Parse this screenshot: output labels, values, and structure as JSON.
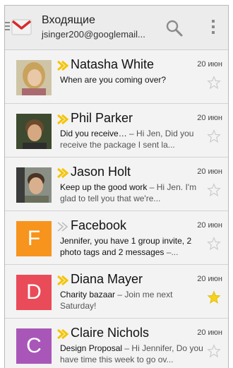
{
  "actionbar": {
    "title": "Входящие",
    "account": "jsinger200@googlemail...",
    "logo_icon": "gmail-envelope-icon",
    "search_icon": "search-icon",
    "overflow_icon": "overflow-menu-icon"
  },
  "colors": {
    "importance_marker": "#f5c400",
    "importance_marker_inactive": "#bdbdbd",
    "facebook_tile": "#f7941d",
    "diana_tile": "#e94b59",
    "claire_tile": "#a857b8",
    "starred": "#f7d21a"
  },
  "messages": [
    {
      "sender": "Natasha White",
      "date": "20 июн",
      "subject": "When are you coming over?",
      "preview": "",
      "starred": false,
      "important": true,
      "avatar": "photo"
    },
    {
      "sender": "Phil Parker",
      "date": "20 июн",
      "subject": "Did you receive…",
      "preview": " – Hi Jen, Did you receive the package I sent la...",
      "starred": false,
      "important": true,
      "avatar": "photo"
    },
    {
      "sender": "Jason Holt",
      "date": "20 июн",
      "subject": "Keep up the good work",
      "preview": " – Hi Jen. I'm glad to tell you that we're...",
      "starred": false,
      "important": true,
      "avatar": "photo"
    },
    {
      "sender": "Facebook",
      "date": "20 июн",
      "subject": "Jennifer, you have 1 group invite, 2 photo tags and 2 messages",
      "preview": " –...",
      "starred": false,
      "important": false,
      "avatar": "F"
    },
    {
      "sender": "Diana Mayer",
      "date": "20 июн",
      "subject": "Charity bazaar",
      "preview": " – Join me next Saturday!",
      "starred": true,
      "important": true,
      "avatar": "D"
    },
    {
      "sender": "Claire Nichols",
      "date": "20 июн",
      "subject": "Design Proposal",
      "preview": " – Hi Jennifer, Do you have time this week to go ov...",
      "starred": false,
      "important": true,
      "avatar": "C"
    }
  ]
}
